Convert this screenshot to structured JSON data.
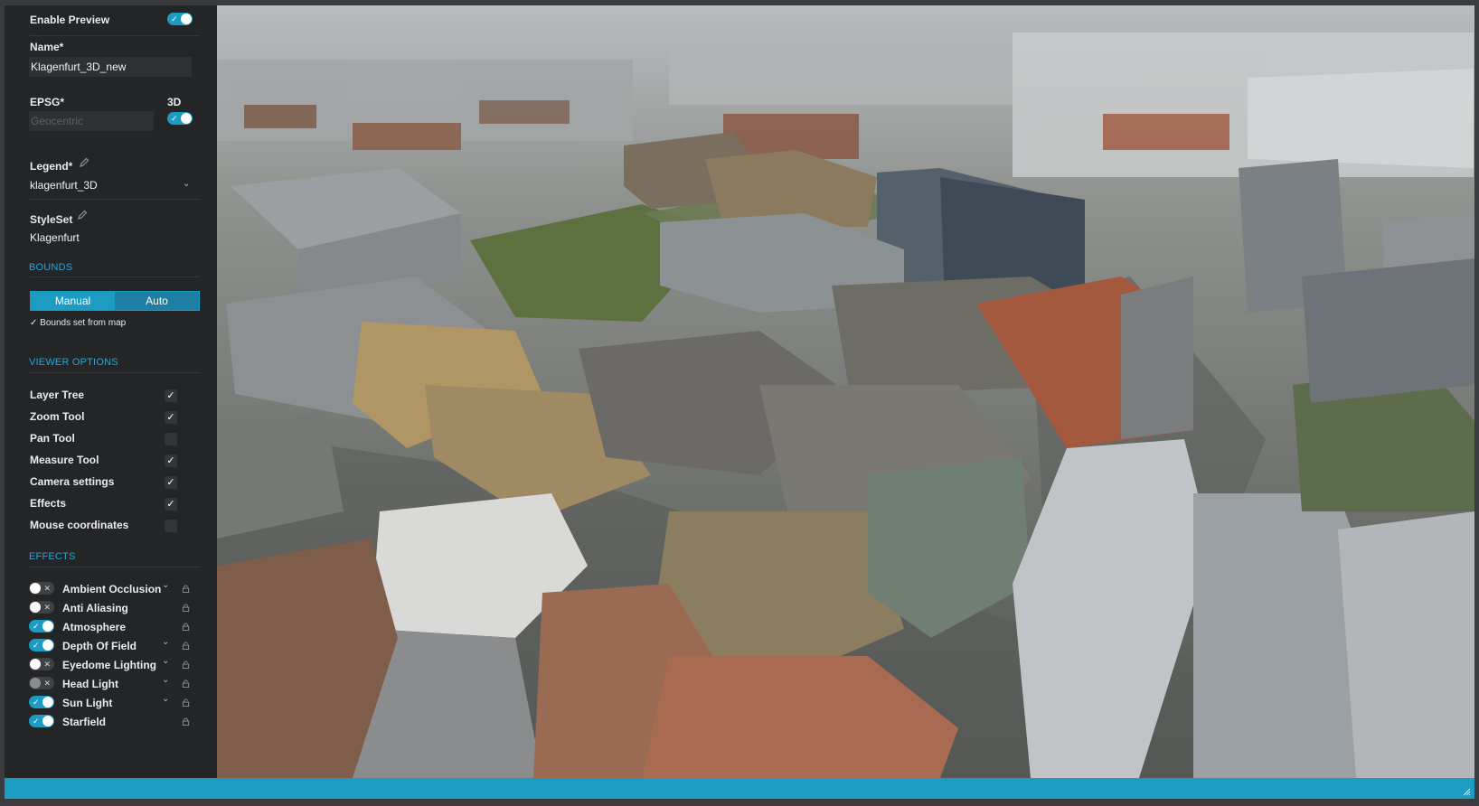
{
  "preview": {
    "label": "Enable Preview",
    "enabled": true
  },
  "name": {
    "label": "Name*",
    "value": "Klagenfurt_3D_new"
  },
  "epsg": {
    "label": "EPSG*",
    "placeholder": "Geocentric",
    "toggle_label": "3D",
    "toggle_on": true
  },
  "legend": {
    "label": "Legend*",
    "value": "klagenfurt_3D"
  },
  "styleset": {
    "label": "StyleSet",
    "value": "Klagenfurt"
  },
  "bounds": {
    "section": "BOUNDS",
    "manual_label": "Manual",
    "auto_label": "Auto",
    "note": "✓ Bounds set from map"
  },
  "viewer_options": {
    "section": "VIEWER OPTIONS",
    "items": [
      {
        "label": "Layer Tree",
        "checked": true
      },
      {
        "label": "Zoom Tool",
        "checked": true
      },
      {
        "label": "Pan Tool",
        "checked": false
      },
      {
        "label": "Measure Tool",
        "checked": true
      },
      {
        "label": "Camera settings",
        "checked": true
      },
      {
        "label": "Effects",
        "checked": true
      },
      {
        "label": "Mouse coordinates",
        "checked": false
      }
    ]
  },
  "effects": {
    "section": "EFFECTS",
    "items": [
      {
        "label": "Ambient Occlusion",
        "on": false,
        "expandable": true
      },
      {
        "label": "Anti Aliasing",
        "on": false,
        "expandable": false
      },
      {
        "label": "Atmosphere",
        "on": true,
        "expandable": false
      },
      {
        "label": "Depth Of Field",
        "on": true,
        "expandable": true
      },
      {
        "label": "Eyedome Lighting",
        "on": false,
        "expandable": true
      },
      {
        "label": "Head Light",
        "on": false,
        "expandable": true
      },
      {
        "label": "Sun Light",
        "on": true,
        "expandable": true
      },
      {
        "label": "Starfield",
        "on": true,
        "expandable": false
      }
    ]
  },
  "icons": {
    "edit": "pencil-icon",
    "dropdown": "chevron-down-icon",
    "lock": "lock-icon",
    "check": "check-icon"
  },
  "colors": {
    "accent": "#1c9bc3",
    "panel": "#242527",
    "section_text": "#2aa6d6"
  }
}
